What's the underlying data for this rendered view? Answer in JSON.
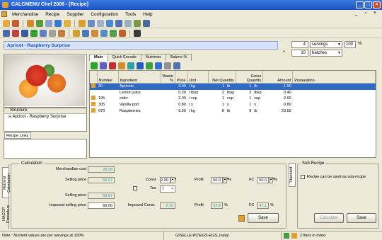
{
  "window": {
    "title": "CALCMENU Chef 2009 - [Recipe]"
  },
  "menu": [
    "Merchandise",
    "Recipe",
    "Supplier",
    "Configuration",
    "Tools",
    "Help"
  ],
  "recipe": {
    "name": "Apricot - Raspberry Surprise"
  },
  "servings": {
    "qty1": "4",
    "unit1": "servings",
    "pct": "100",
    "pct_sign": "%",
    "qty2": "10",
    "unit2": "batches",
    "star": "*"
  },
  "tabs": [
    "Main",
    "Quick Encode",
    "Nutrients",
    "Bakers %"
  ],
  "structure": {
    "header": "Structure",
    "item": "Apricot - Raspberry Surprise"
  },
  "recipe_links": "Recipe Links",
  "ingredients": {
    "headers": {
      "number": "Number",
      "ingredient": "Ingredient",
      "waste": "Waste %",
      "price": "Price",
      "unit": "Unit",
      "net_qty": "Net Quantity",
      "gross_qty": "Gross Quantity",
      "amount": "Amount",
      "prep": "Preparation"
    },
    "rows": [
      {
        "number": "30",
        "ingredient": "Apricots",
        "waste": "",
        "price": "3.30",
        "unit": "/ kg",
        "net": "1",
        "net_u": "lb",
        "gross": "1",
        "gross_u": "lb",
        "amount": "1.50"
      },
      {
        "number": "",
        "ingredient": "Lemon juice",
        "waste": "",
        "price": "0.20",
        "unit": "/ tbsp",
        "net": "2",
        "net_u": "tbsp",
        "gross": "2",
        "gross_u": "tbsp",
        "amount": "0.40"
      },
      {
        "number": "195",
        "ingredient": "cider",
        "waste": "",
        "price": "2.00",
        "unit": "/ cup",
        "net": "1",
        "net_u": "cup",
        "gross": "1",
        "gross_u": "cup",
        "amount": "2.00"
      },
      {
        "number": "305",
        "ingredient": "Vanilla pod",
        "waste": "",
        "price": "0.80",
        "unit": "/ x",
        "net": "1",
        "net_u": "x",
        "gross": "1",
        "gross_u": "x",
        "amount": "0.80"
      },
      {
        "number": "670",
        "ingredient": "Raspberries",
        "waste": "",
        "price": "6.50",
        "unit": "/ kg",
        "net": "8",
        "net_u": "lb",
        "gross": "8",
        "gross_u": "lb",
        "amount": "23.59"
      }
    ]
  },
  "calculation": {
    "legend": "Calculation",
    "merch_cost_label": "Merchandise cost",
    "merch_cost": "28.28",
    "selling_price_label": "Selling price",
    "selling_price": "56.57",
    "const_label": "Const.",
    "const": "2.00",
    "tax_label": "Tax",
    "tax": "0",
    "profit_label": "Profit",
    "profit": "50.0",
    "fc_label": "FC",
    "fc": "50.0",
    "pct": "%",
    "selling_price2_label": "Selling price",
    "selling_price2": "56.57",
    "imposed_label": "Imposed selling price",
    "imposed": "60.00",
    "imposed_const_label": "Imposed Const.",
    "imposed_const": "2.12",
    "profit2": "52.9",
    "fc2": "47.1",
    "save": "Save"
  },
  "side_tabs": {
    "nutrient": "Nutrient Calculation",
    "haccp": "HACCP Procedure",
    "standard": "Standard"
  },
  "sub_recipe": {
    "legend": "Sub-Recipe",
    "checkbox": "Recipe can be used as sub-recipe",
    "calculate": "Calculate",
    "save": "Save"
  },
  "status": {
    "note": "Note : Nutrient values are per servings at 100%",
    "user": "GISELLE-PC\\EGS-EGS_Instal",
    "inbox": "2 file/s in Inbox"
  }
}
